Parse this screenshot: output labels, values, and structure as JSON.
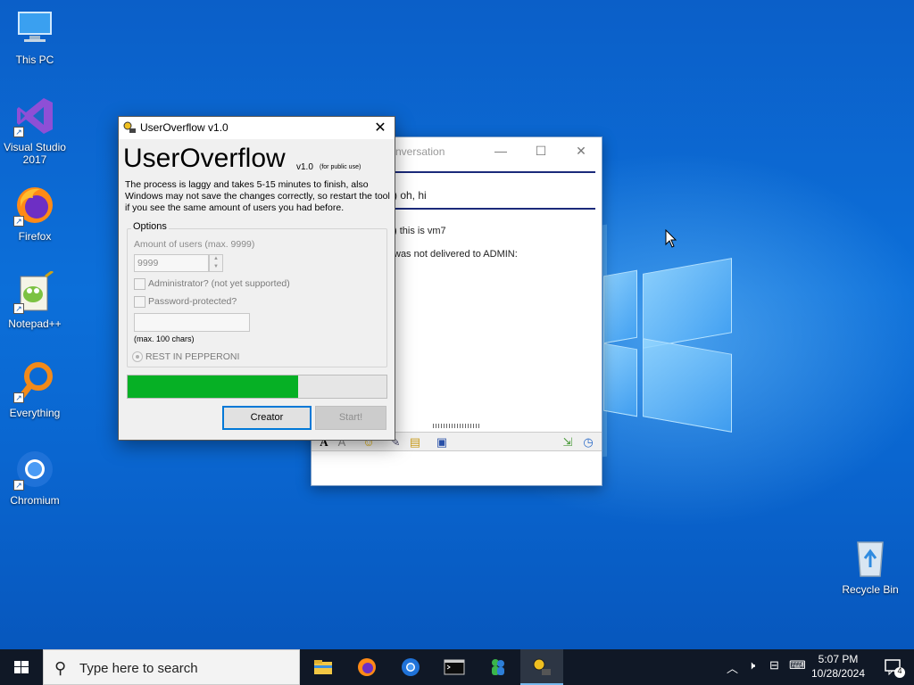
{
  "desktop": {
    "icons": [
      {
        "label": "This PC",
        "icon": "monitor-icon"
      },
      {
        "label": "Visual Studio\n2017",
        "icon": "visual-studio-icon"
      },
      {
        "label": "Firefox",
        "icon": "firefox-icon"
      },
      {
        "label": "Notepad++",
        "icon": "notepadpp-icon"
      },
      {
        "label": "Everything",
        "icon": "everything-search-icon"
      },
      {
        "label": "Chromium",
        "icon": "chromium-icon"
      },
      {
        "label": "Recycle Bin",
        "icon": "recycle-bin-icon"
      }
    ]
  },
  "chat_window": {
    "title_partial": "nversation",
    "messages": [
      {
        "text": ") oh, hi"
      },
      {
        "text": ") this is vm7"
      },
      {
        "text": "was not delivered to ADMIN:"
      }
    ],
    "title_color": "#999999",
    "divider_color": "#1b2a7a"
  },
  "useroverflow": {
    "window_title": "UserOverflow v1.0",
    "heading": "UserOverflow",
    "version": "v1.0",
    "public_note": "(for public use)",
    "description": "The process is laggy and takes 5-15 minutes to finish, also Windows may not save the changes correctly, so restart the tool if you see the same amount of users you had before.",
    "options_label": "Options",
    "amount_label": "Amount of users (max. 9999)",
    "amount_value": "9999",
    "admin_label": "Administrator? (not yet supported)",
    "password_label": "Password-protected?",
    "max_chars_label": "(max. 100 chars)",
    "radio_label": "REST IN PEPPERONI",
    "progress_fraction": 0.66,
    "progress_color": "#06b025",
    "creator_label": "Creator",
    "start_label": "Start!",
    "close_glyph": "✕"
  },
  "taskbar": {
    "search_placeholder": "Type here to search",
    "time": "5:07 PM",
    "date": "10/28/2024",
    "notification_count": "4",
    "apps": [
      {
        "name": "file-explorer-icon"
      },
      {
        "name": "firefox-icon"
      },
      {
        "name": "chromium-icon"
      },
      {
        "name": "terminal-icon"
      },
      {
        "name": "messenger-icon"
      },
      {
        "name": "useroverflow-icon",
        "active": true
      }
    ]
  }
}
